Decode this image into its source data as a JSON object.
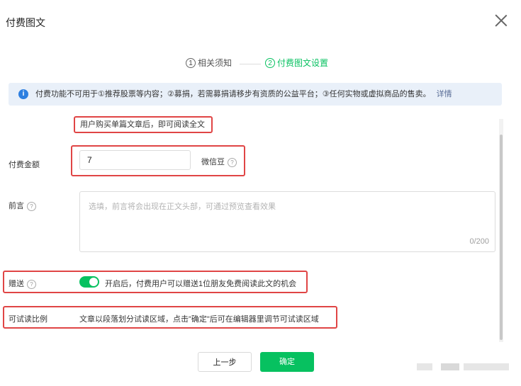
{
  "dialog": {
    "title": "付费图文",
    "close_icon": "close-icon"
  },
  "steps": [
    {
      "number": "1",
      "label": "相关须知",
      "active": false
    },
    {
      "number": "2",
      "label": "付费图文设置",
      "active": true
    }
  ],
  "notice": {
    "icon": "info-icon",
    "text": "付费功能不可用于①推荐股票等内容；②募捐，若需募捐请移步有资质的公益平台；③任何实物或虚拟商品的售卖。",
    "link": "详情"
  },
  "form": {
    "subscription_hint": "用户购买单篇文章后，即可阅读全文",
    "price": {
      "label": "付费金额",
      "value": "7",
      "unit": "微信豆"
    },
    "preface": {
      "label": "前言",
      "placeholder": "选填，前言将会出现在正文头部，可通过预览查看效果",
      "counter": "0/200"
    },
    "gift": {
      "label": "赠送",
      "enabled": true,
      "description": "开启后，付费用户可以赠送1位朋友免费阅读此文的机会"
    },
    "trial": {
      "label": "可试读比例",
      "description": "文章以段落划分试读区域，点击\"确定\"后可在编辑器里调节可试读区域"
    }
  },
  "buttons": {
    "prev": "上一步",
    "confirm": "确定"
  },
  "colors": {
    "accent": "#07c160",
    "link": "#576b95",
    "highlight_border": "#e04545",
    "notice_bg": "#e9f0f9"
  }
}
